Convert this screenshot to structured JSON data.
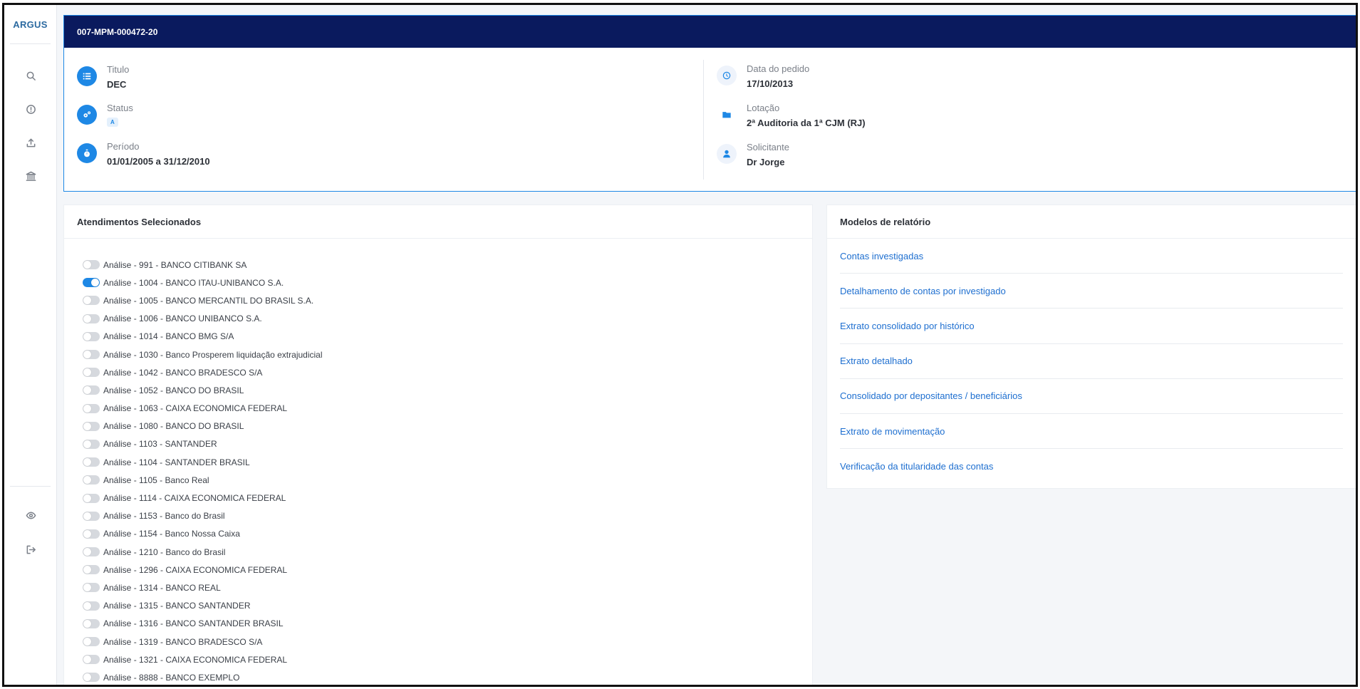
{
  "app": {
    "logo": "ARGUS"
  },
  "sidebar": {
    "icons": [
      "search-icon",
      "alert-circle-icon",
      "upload-icon",
      "bank-icon",
      "eye-icon",
      "logout-icon"
    ]
  },
  "header": {
    "case_id": "007-MPM-000472-20",
    "left": {
      "titulo_label": "Titulo",
      "titulo_value": "DEC",
      "status_label": "Status",
      "status_value": "A",
      "periodo_label": "Período",
      "periodo_value": "01/01/2005 a 31/12/2010"
    },
    "right": {
      "data_label": "Data do pedido",
      "data_value": "17/10/2013",
      "lotacao_label": "Lotação",
      "lotacao_value": "2ª Auditoria da 1ª CJM (RJ)",
      "solicitante_label": "Solicitante",
      "solicitante_value": "Dr Jorge"
    }
  },
  "atendimentos": {
    "title": "Atendimentos Selecionados",
    "items": [
      {
        "label": "Análise - 991 - BANCO CITIBANK SA",
        "checked": false
      },
      {
        "label": "Análise - 1004 - BANCO ITAU-UNIBANCO S.A.",
        "checked": true
      },
      {
        "label": "Análise - 1005 - BANCO MERCANTIL DO BRASIL S.A.",
        "checked": false
      },
      {
        "label": "Análise - 1006 - BANCO UNIBANCO S.A.",
        "checked": false
      },
      {
        "label": "Análise - 1014 - BANCO BMG S/A",
        "checked": false
      },
      {
        "label": "Análise - 1030 - Banco Prosperem liquidação extrajudicial",
        "checked": false
      },
      {
        "label": "Análise - 1042 - BANCO BRADESCO S/A",
        "checked": false
      },
      {
        "label": "Análise - 1052 - BANCO DO BRASIL",
        "checked": false
      },
      {
        "label": "Análise - 1063 - CAIXA ECONOMICA FEDERAL",
        "checked": false
      },
      {
        "label": "Análise - 1080 - BANCO DO BRASIL",
        "checked": false
      },
      {
        "label": "Análise - 1103 - SANTANDER",
        "checked": false
      },
      {
        "label": "Análise - 1104 - SANTANDER BRASIL",
        "checked": false
      },
      {
        "label": "Análise - 1105 - Banco Real",
        "checked": false
      },
      {
        "label": "Análise - 1114 - CAIXA ECONOMICA FEDERAL",
        "checked": false
      },
      {
        "label": "Análise - 1153 - Banco do Brasil",
        "checked": false
      },
      {
        "label": "Análise - 1154 - Banco Nossa Caixa",
        "checked": false
      },
      {
        "label": "Análise - 1210 - Banco do Brasil",
        "checked": false
      },
      {
        "label": "Análise - 1296 - CAIXA ECONOMICA FEDERAL",
        "checked": false
      },
      {
        "label": "Análise - 1314 - BANCO REAL",
        "checked": false
      },
      {
        "label": "Análise - 1315 - BANCO SANTANDER",
        "checked": false
      },
      {
        "label": "Análise - 1316 - BANCO SANTANDER BRASIL",
        "checked": false
      },
      {
        "label": "Análise - 1319 - BANCO BRADESCO S/A",
        "checked": false
      },
      {
        "label": "Análise - 1321 - CAIXA ECONOMICA FEDERAL",
        "checked": false
      },
      {
        "label": "Análise - 8888 - BANCO EXEMPLO",
        "checked": false
      }
    ]
  },
  "modelos": {
    "title": "Modelos de relatório",
    "items": [
      "Contas investigadas",
      "Detalhamento de contas por investigado",
      "Extrato consolidado por histórico",
      "Extrato detalhado",
      "Consolidado por depositantes / beneficiários",
      "Extrato de movimentação",
      "Verificação da titularidade das contas"
    ]
  },
  "colors": {
    "accent": "#1e88e5",
    "header_bar": "#0a1a5e",
    "link": "#1e6fd0"
  }
}
